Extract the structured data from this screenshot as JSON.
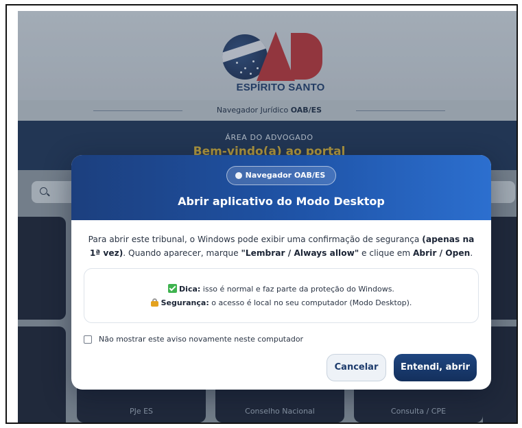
{
  "background": {
    "logo_text": "ESPÍRITO SANTO",
    "nav_strip": {
      "prefix": "Navegador Jurídico ",
      "bold": "OAB/ES"
    },
    "hero": {
      "kicker": "ÁREA DO ADVOGADO",
      "welcome": "Bem-vindo(a) ao portal"
    },
    "tiles": [
      "PJe ES",
      "Conselho Nacional",
      "Consulta / CPE"
    ]
  },
  "modal": {
    "badge": "Navegador OAB/ES",
    "title": "Abrir aplicativo do Modo Desktop",
    "description": {
      "part1": "Para abrir este tribunal, o Windows pode exibir uma confirmação de segurança ",
      "bold1": "(apenas na 1ª vez)",
      "part2": ". Quando aparecer, marque ",
      "bold2": "\"Lembrar / Always allow\"",
      "part3": " e clique em ",
      "bold3": "Abrir / Open",
      "part4": "."
    },
    "tip": {
      "label": "Dica:",
      "text": " isso é normal e faz parte da proteção do Windows."
    },
    "security": {
      "label": "Segurança:",
      "text": " o acesso é local no seu computador (Modo Desktop)."
    },
    "dont_show_label": "Não mostrar este aviso novamente neste computador",
    "dont_show_checked": false,
    "cancel_label": "Cancelar",
    "confirm_label": "Entendi, abrir"
  },
  "colors": {
    "modal_header_start": "#1c3f7e",
    "modal_header_end": "#2c6fcf",
    "primary_button": "#132f5c",
    "brand_red": "#a5333a",
    "brand_navy": "#1e3a67"
  }
}
